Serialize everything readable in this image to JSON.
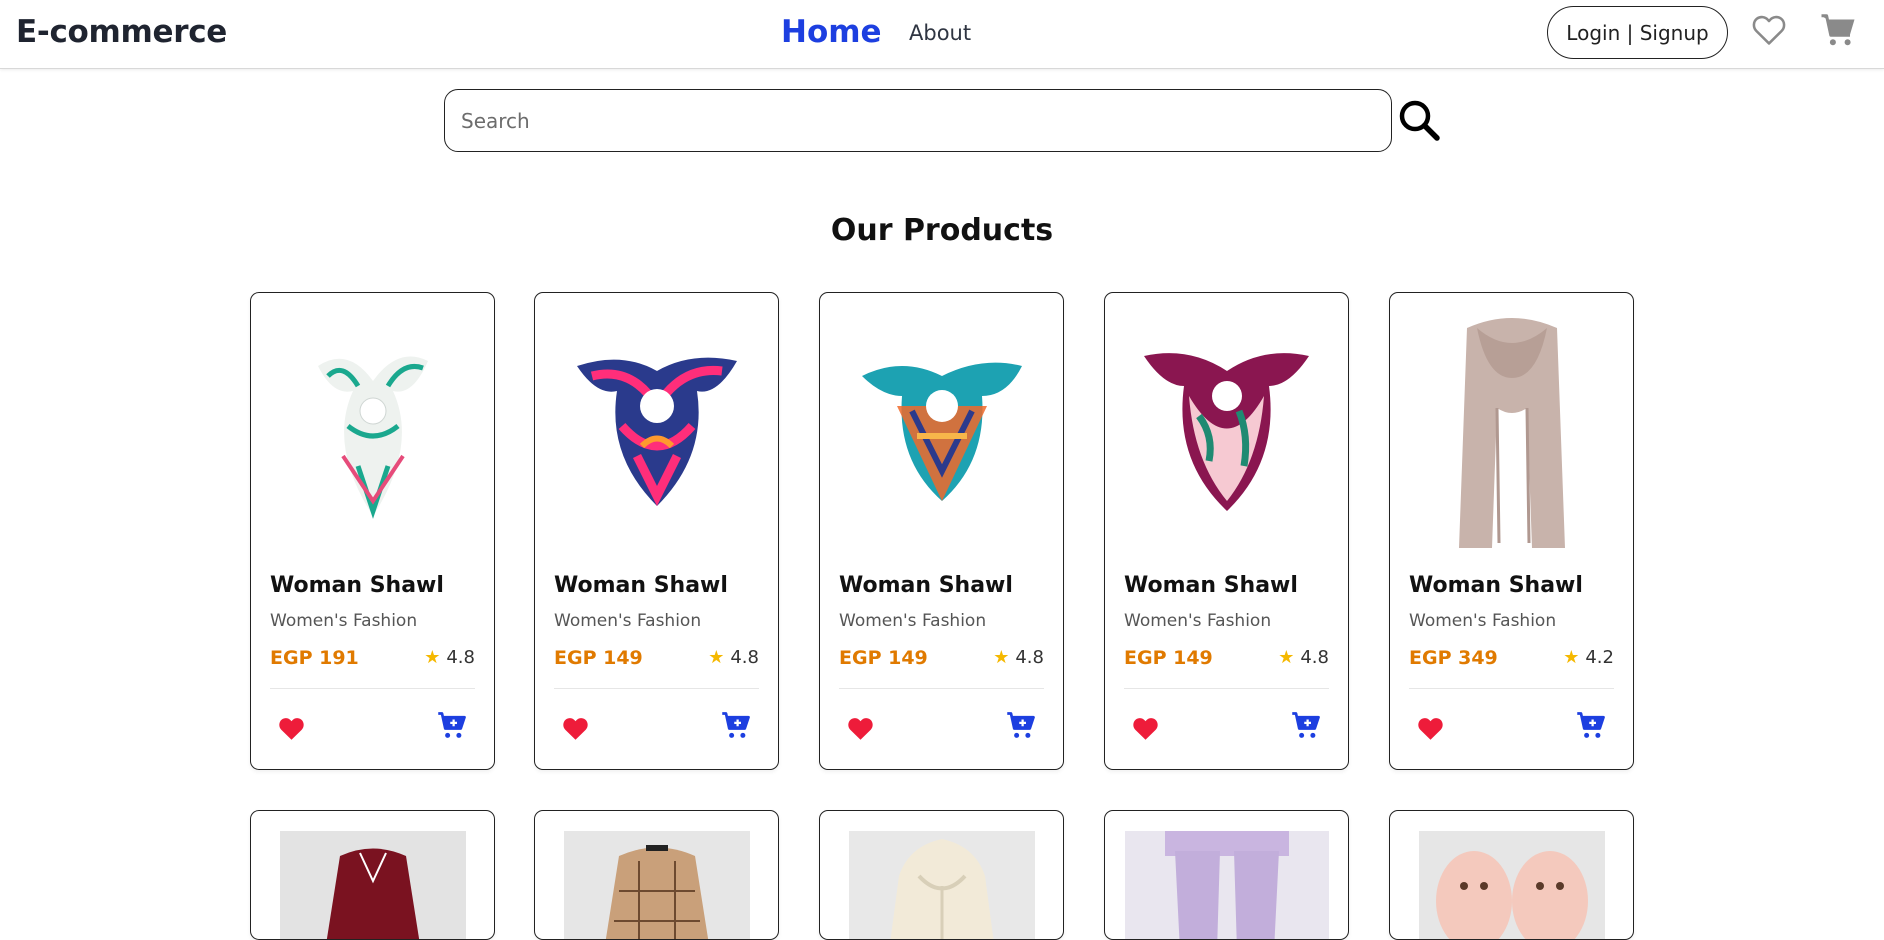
{
  "nav": {
    "brand": "E-commerce",
    "home": "Home",
    "about": "About",
    "login_label": "Login | Signup"
  },
  "search": {
    "placeholder": "Search"
  },
  "section_title": "Our Products",
  "products": [
    {
      "name": "Woman Shawl",
      "category": "Women's Fashion",
      "price": "EGP 191",
      "rating": "4.8",
      "image": "scarf-white-teal"
    },
    {
      "name": "Woman Shawl",
      "category": "Women's Fashion",
      "price": "EGP 149",
      "rating": "4.8",
      "image": "scarf-pink-navy"
    },
    {
      "name": "Woman Shawl",
      "category": "Women's Fashion",
      "price": "EGP 149",
      "rating": "4.8",
      "image": "scarf-orange-teal"
    },
    {
      "name": "Woman Shawl",
      "category": "Women's Fashion",
      "price": "EGP 149",
      "rating": "4.8",
      "image": "scarf-plum-pink"
    },
    {
      "name": "Woman Shawl",
      "category": "Women's Fashion",
      "price": "EGP 349",
      "rating": "4.2",
      "image": "scarf-beige-long"
    }
  ],
  "products_row2": [
    {
      "image": "shirt-burgundy"
    },
    {
      "image": "shirt-plaid-brown"
    },
    {
      "image": "hoodie-cream"
    },
    {
      "image": "pants-lavender"
    },
    {
      "image": "slippers-pink"
    }
  ],
  "colors": {
    "accent": "#1d3fe0",
    "price": "#e07a00",
    "heart": "#ee1c3a",
    "star": "#f5b800"
  }
}
